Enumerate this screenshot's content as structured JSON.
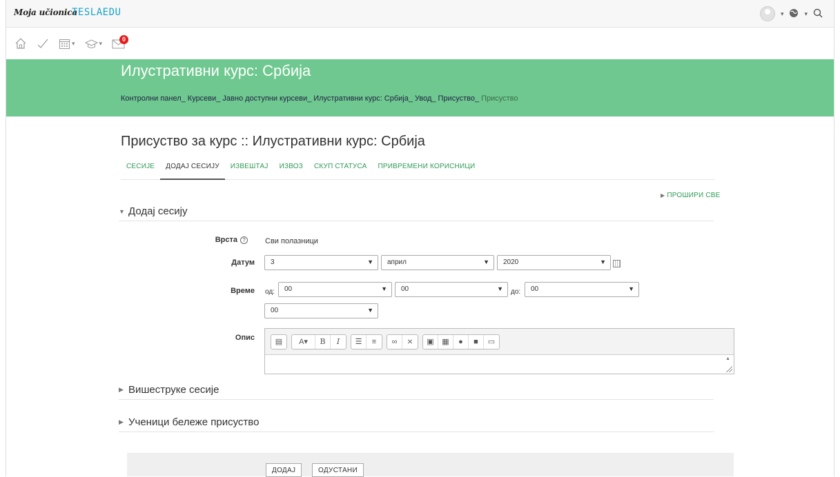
{
  "brand": {
    "name": "Moja učionica",
    "partner": "TESLAEDU"
  },
  "nav": {
    "user_menu": "user",
    "language_menu": "language",
    "search": "search",
    "icons": [
      "home-icon",
      "check-icon",
      "calendar-icon",
      "graduation-cap-icon",
      "envelope-icon"
    ],
    "mail_badge": "0"
  },
  "header": {
    "course_title": "Илустративни курс: Србија",
    "breadcrumbs": [
      "Контролни панел",
      "Курсеви",
      "Јавно доступни курсеви",
      "Илустративни курс: Србија",
      "Увод",
      "Присуство",
      "Присуство"
    ]
  },
  "page": {
    "title": "Присуство за курс :: Илустративни курс: Србија",
    "tabs": [
      "СЕСИЈЕ",
      "ДОДАЈ СЕСИЈУ",
      "ИЗВЕШТАЈ",
      "ИЗВОЗ",
      "СКУП СТАТУСА",
      "ПРИВРЕМЕНИ КОРИСНИЦИ"
    ],
    "active_tab": "ДОДАЈ СЕСИЈУ",
    "expand_all": "ПРОШИРИ СВЕ"
  },
  "form": {
    "section_add": "Додај сесију",
    "type_label": "Врста",
    "type_value": "Сви полазници",
    "date_label": "Датум",
    "date_day": "3",
    "date_month": "април",
    "date_year": "2020",
    "time_label": "Време",
    "from_label": "од:",
    "to_label": "до:",
    "from_hour": "00",
    "from_minute": "00",
    "to_hour": "00",
    "to_minute": "00",
    "description_label": "Опис",
    "section_multiple": "Вишеструке сесије",
    "section_students": "Ученици бележе присуство",
    "add_button": "ДОДАЈ",
    "cancel_button": "ОДУСТАНИ"
  }
}
